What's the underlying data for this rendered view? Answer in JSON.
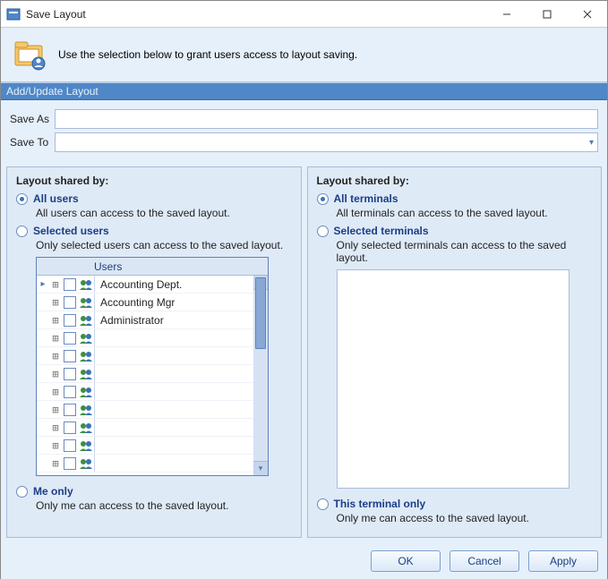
{
  "window": {
    "title": "Save Layout"
  },
  "info": {
    "text": "Use the selection below to grant users access to layout saving."
  },
  "section_bar": "Add/Update Layout",
  "form": {
    "save_as_label": "Save As",
    "save_as_value": "",
    "save_to_label": "Save To",
    "save_to_value": ""
  },
  "left": {
    "title": "Layout shared by:",
    "opt_all": {
      "label": "All users",
      "desc": "All users can access to the saved layout.",
      "checked": true
    },
    "opt_selected": {
      "label": "Selected users",
      "desc": "Only selected users can access to the saved layout.",
      "checked": false
    },
    "opt_me": {
      "label": "Me only",
      "desc": "Only me can access to the saved layout.",
      "checked": false
    },
    "grid": {
      "header": "Users",
      "rows": [
        {
          "name": "Accounting Dept.",
          "pointer": true
        },
        {
          "name": "Accounting Mgr"
        },
        {
          "name": "Administrator"
        },
        {
          "name": ""
        },
        {
          "name": ""
        },
        {
          "name": ""
        },
        {
          "name": ""
        },
        {
          "name": ""
        },
        {
          "name": ""
        },
        {
          "name": ""
        },
        {
          "name": ""
        }
      ]
    }
  },
  "right": {
    "title": "Layout shared by:",
    "opt_all": {
      "label": "All terminals",
      "desc": "All terminals can access to the saved layout.",
      "checked": true
    },
    "opt_selected": {
      "label": "Selected terminals",
      "desc": "Only selected terminals can access to the saved layout.",
      "checked": false
    },
    "opt_this": {
      "label": "This terminal only",
      "desc": "Only me can access to the saved layout.",
      "checked": false
    }
  },
  "buttons": {
    "ok": "OK",
    "cancel": "Cancel",
    "apply": "Apply"
  }
}
